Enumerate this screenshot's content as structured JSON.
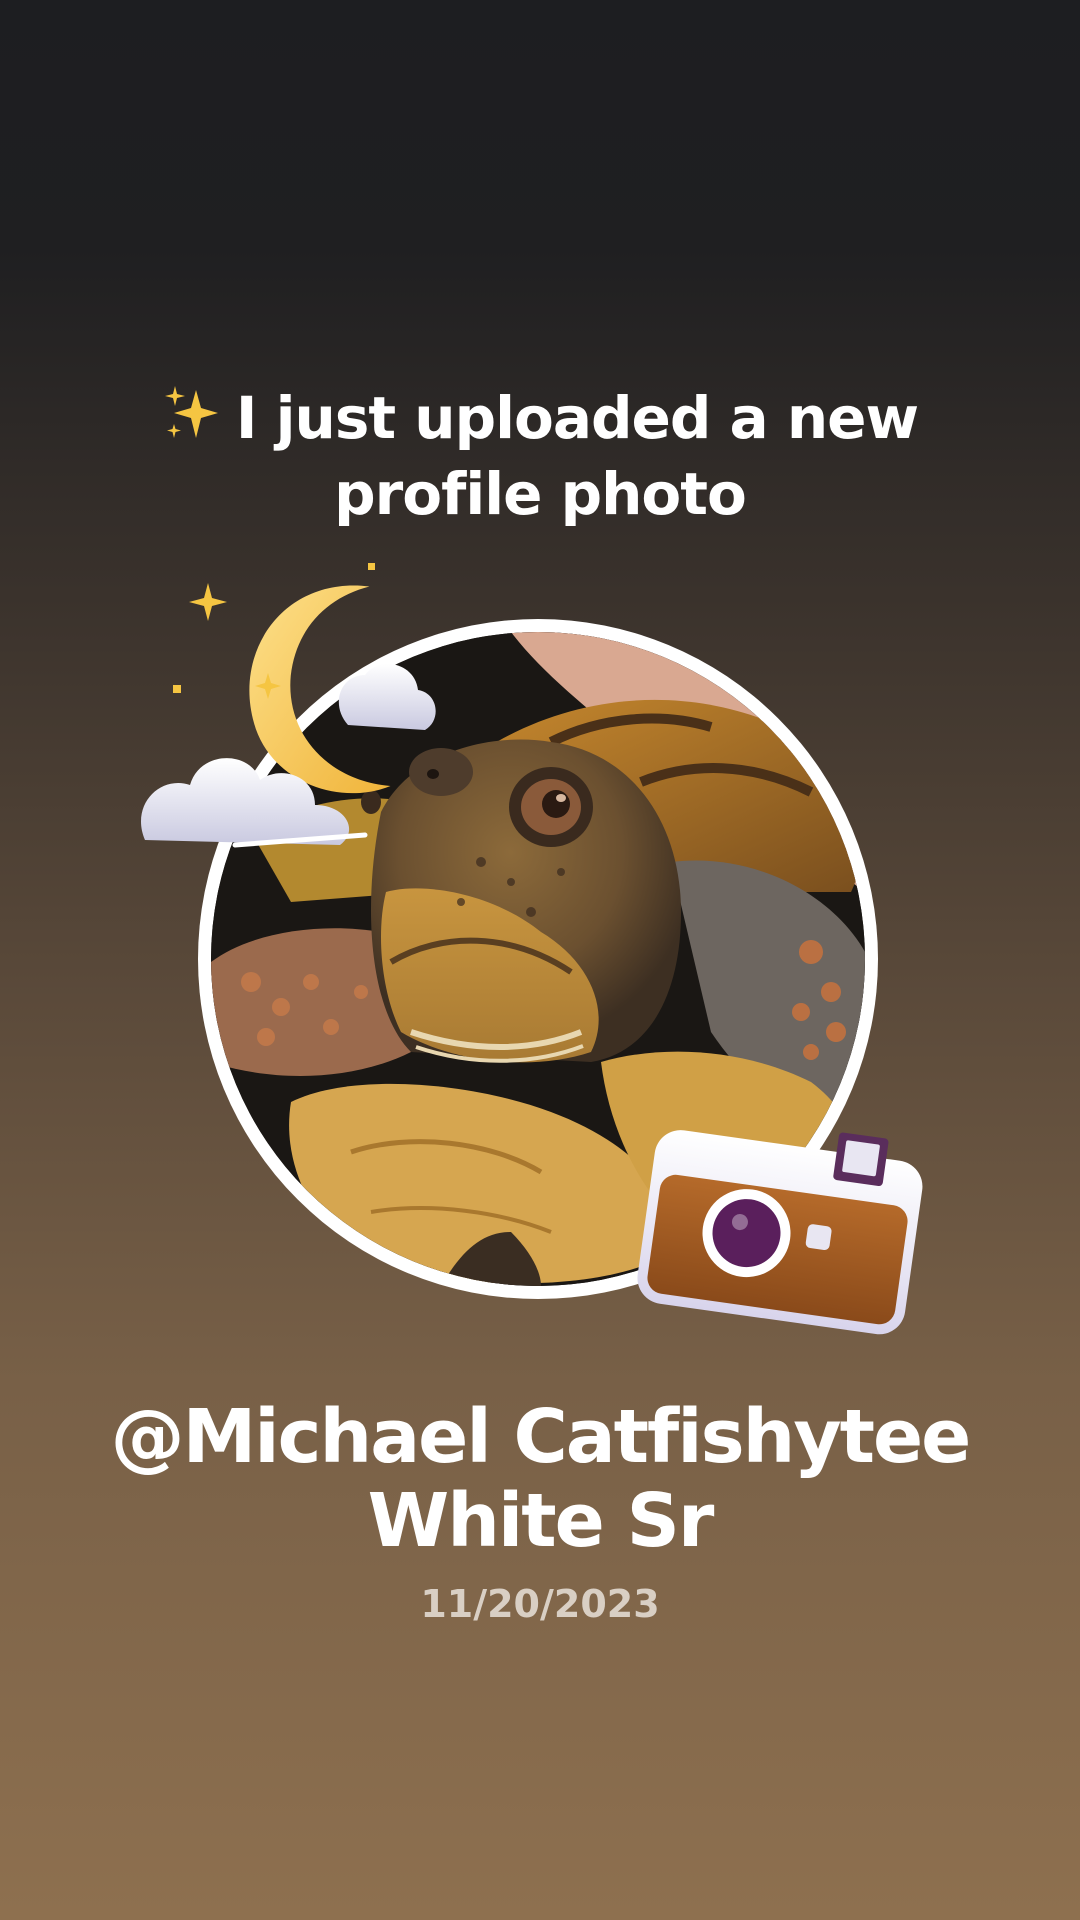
{
  "announcement": {
    "emoji_icon": "sparkles-icon",
    "line1": "I just uploaded a new",
    "line2": "profile photo"
  },
  "profile": {
    "photo_subject": "turtle-photo",
    "username_line1": "@Michael Catfishytee",
    "username_line2": "White Sr",
    "date": "11/20/2023"
  },
  "stickers": {
    "moon": "moon-clouds-icon",
    "camera": "camera-icon"
  },
  "colors": {
    "background_top": "#1d1e21",
    "background_bottom": "#8e704f",
    "text": "#ffffff",
    "date_text": "#d9cfc4",
    "ring": "#ffffff"
  }
}
